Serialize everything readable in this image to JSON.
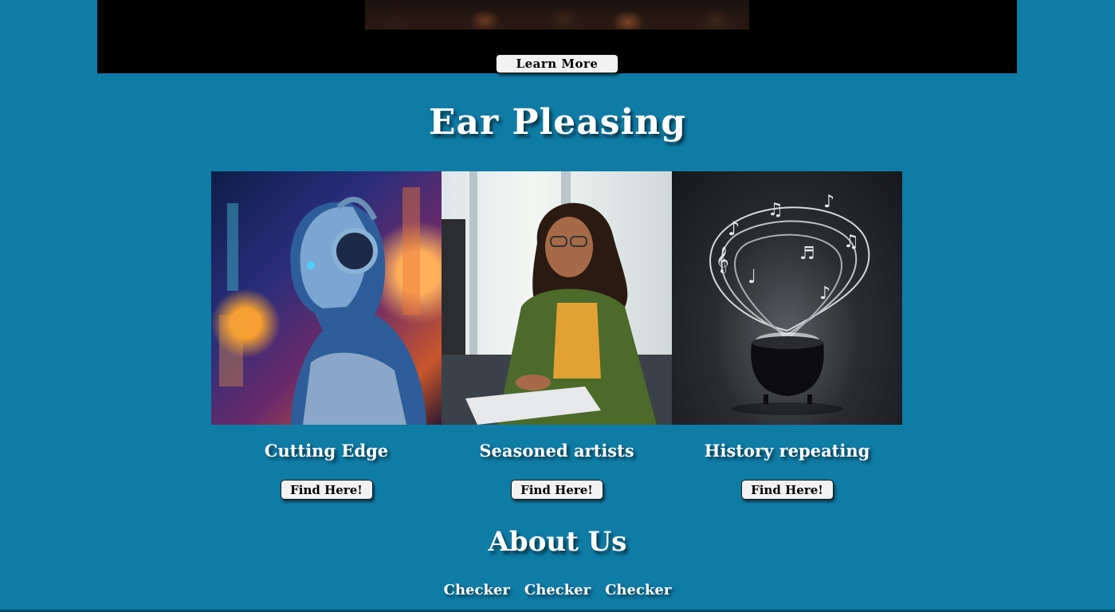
{
  "hero": {
    "learn_more_label": "Learn More"
  },
  "section": {
    "title": "Ear Pleasing",
    "cards": [
      {
        "title": "Cutting Edge",
        "button": "Find Here!"
      },
      {
        "title": "Seasoned artists",
        "button": "Find Here!"
      },
      {
        "title": "History repeating",
        "button": "Find Here!"
      }
    ]
  },
  "about": {
    "title": "About Us",
    "links": [
      "Checker",
      "Checker",
      "Checker"
    ]
  },
  "colors": {
    "background": "#0f7ca6",
    "hero_background": "#000000",
    "button_background": "#f2f2f2",
    "text": "#ffffff"
  }
}
